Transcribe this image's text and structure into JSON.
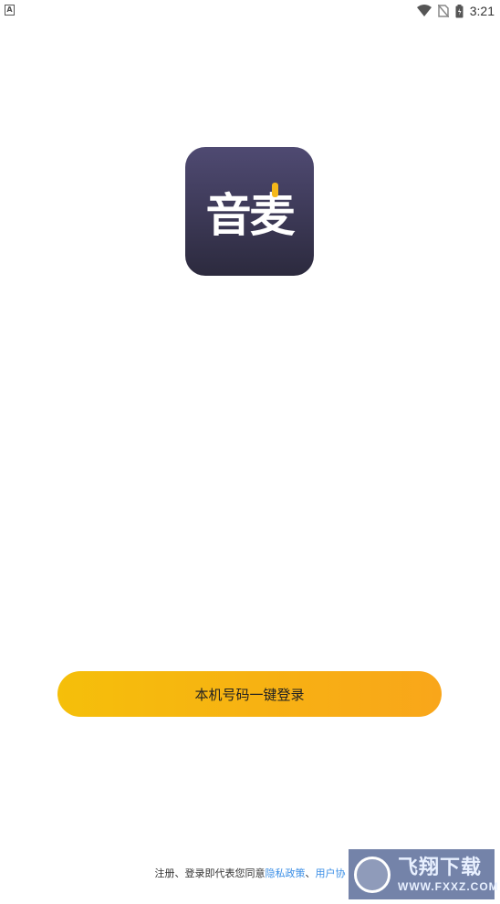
{
  "status_bar": {
    "time": "3:21",
    "left_icon": "A"
  },
  "app": {
    "logo_text": "音麦",
    "logo_colors": [
      "#4f4a72",
      "#2c2a3e"
    ],
    "logo_accent": "#f5b81a"
  },
  "login": {
    "button_label": "本机号码一键登录",
    "gradient": [
      "#f5bf0a",
      "#f9a61a"
    ]
  },
  "agreement": {
    "prefix": "注册、登录即代表您同意",
    "privacy_link": "隐私政策",
    "separator": "、",
    "terms_link": "用户协"
  },
  "watermark": {
    "main": "飞翔下载",
    "sub": "WWW.FXXZ.COM"
  }
}
